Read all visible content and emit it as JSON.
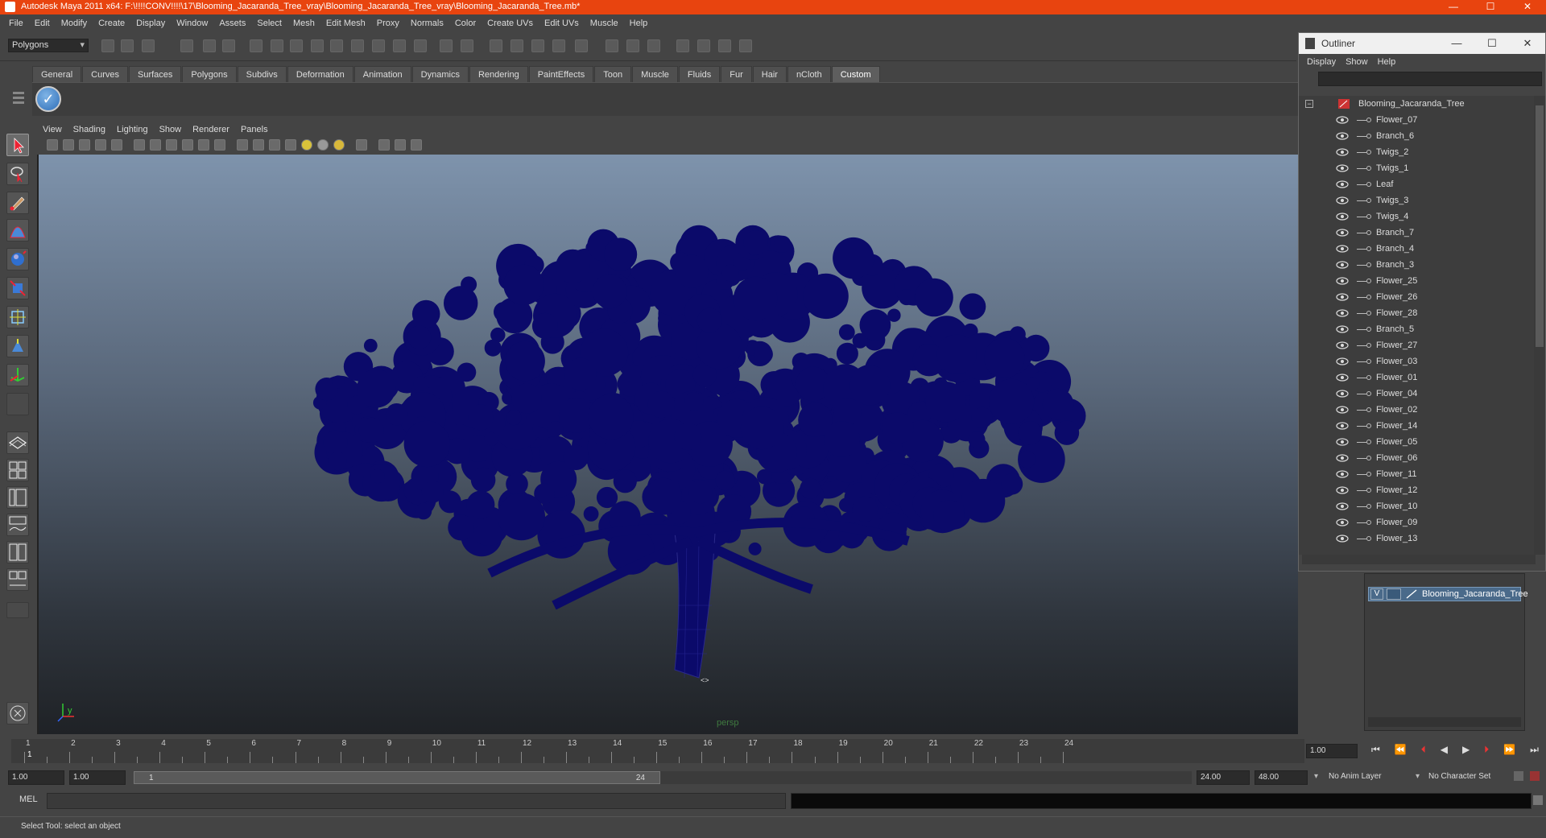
{
  "window": {
    "title": "Autodesk Maya 2011 x64: F:\\!!!!CONV!!!!\\17\\Blooming_Jacaranda_Tree_vray\\Blooming_Jacaranda_Tree_vray\\Blooming_Jacaranda_Tree.mb*",
    "controls": [
      "—",
      "☐",
      "✕"
    ]
  },
  "menubar": [
    "File",
    "Edit",
    "Modify",
    "Create",
    "Display",
    "Window",
    "Assets",
    "Select",
    "Mesh",
    "Edit Mesh",
    "Proxy",
    "Normals",
    "Color",
    "Create UVs",
    "Edit UVs",
    "Muscle",
    "Help"
  ],
  "toolbar": {
    "mode": "Polygons"
  },
  "shelf": {
    "tabs": [
      "General",
      "Curves",
      "Surfaces",
      "Polygons",
      "Subdivs",
      "Deformation",
      "Animation",
      "Dynamics",
      "Rendering",
      "PaintEffects",
      "Toon",
      "Muscle",
      "Fluids",
      "Fur",
      "Hair",
      "nCloth",
      "Custom"
    ],
    "active_tab": "Custom"
  },
  "viewport": {
    "menu": [
      "View",
      "Shading",
      "Lighting",
      "Show",
      "Renderer",
      "Panels"
    ],
    "camera_label": "persp",
    "object_color": "#0b0a6a",
    "axis": {
      "y": "y",
      "x": "x"
    }
  },
  "outliner": {
    "title": "Outliner",
    "menu": [
      "Display",
      "Show",
      "Help"
    ],
    "root": "Blooming_Jacaranda_Tree",
    "items": [
      "Flower_07",
      "Branch_6",
      "Twigs_2",
      "Twigs_1",
      "Leaf",
      "Twigs_3",
      "Twigs_4",
      "Branch_7",
      "Branch_4",
      "Branch_3",
      "Flower_25",
      "Flower_26",
      "Flower_28",
      "Branch_5",
      "Flower_27",
      "Flower_03",
      "Flower_01",
      "Flower_04",
      "Flower_02",
      "Flower_14",
      "Flower_05",
      "Flower_06",
      "Flower_11",
      "Flower_12",
      "Flower_10",
      "Flower_09",
      "Flower_13"
    ]
  },
  "layers": {
    "visible_flag": "V",
    "layer_name": "Blooming_Jacaranda_Tree"
  },
  "timeline": {
    "ticks": [
      "1",
      "2",
      "3",
      "4",
      "5",
      "6",
      "7",
      "8",
      "9",
      "10",
      "11",
      "12",
      "13",
      "14",
      "15",
      "16",
      "17",
      "18",
      "19",
      "20",
      "21",
      "22",
      "23",
      "24"
    ],
    "current_marker": "1",
    "current_frame": "1.00"
  },
  "range": {
    "start": "1.00",
    "start_inner": "1.00",
    "slider_left": "1",
    "slider_right": "24",
    "end_inner": "24.00",
    "end": "48.00",
    "anim_layer": "No Anim Layer",
    "character_set": "No Character Set"
  },
  "mel": {
    "label": "MEL"
  },
  "status": {
    "help_text": "Select Tool: select an object"
  }
}
